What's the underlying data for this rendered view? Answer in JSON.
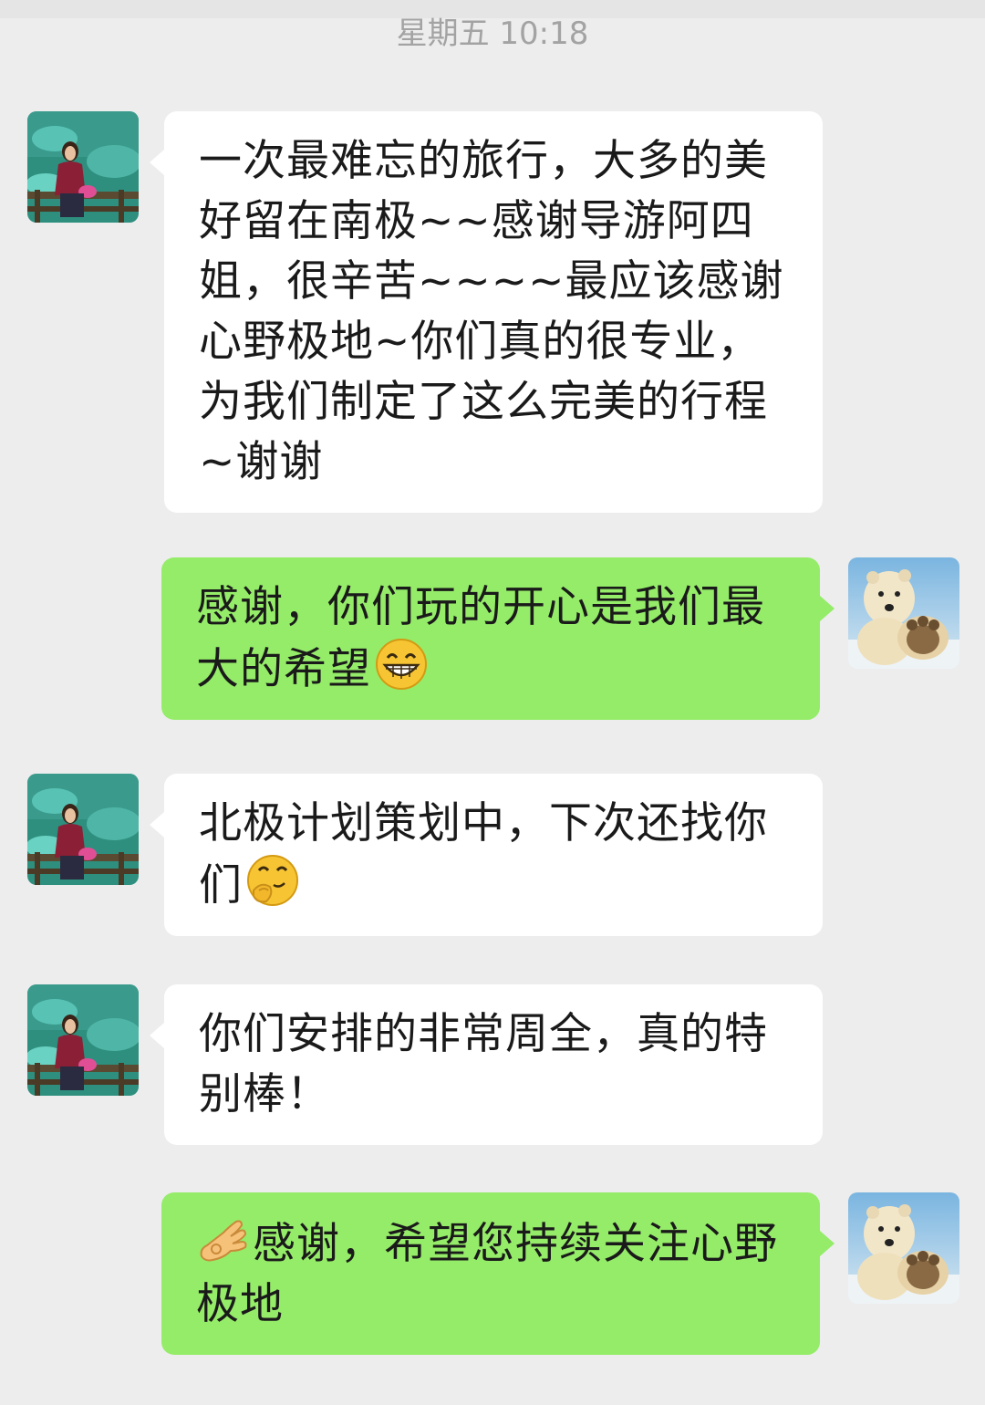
{
  "chat": {
    "timestamp": "星期五 10:18",
    "messages": [
      {
        "sender": "customer",
        "text": "一次最难忘的旅行，大多的美好留在南极~~感谢导游阿四姐，很辛苦~~~~最应该感谢心野极地~你们真的很专业，为我们制定了这么完美的行程~谢谢"
      },
      {
        "sender": "agency",
        "text": "感谢，你们玩的开心是我们最大的希望",
        "emoji": "grinning-face-icon"
      },
      {
        "sender": "customer",
        "text": "北极计划策划中，下次还找你们",
        "emoji": "thinking-face-icon"
      },
      {
        "sender": "customer",
        "text": "你们安排的非常周全，真的特别棒！"
      },
      {
        "sender": "agency",
        "text": "感谢，希望您持续关注心野极地",
        "emoji": "ok-hand-icon"
      }
    ]
  },
  "colors": {
    "background": "#ededed",
    "incoming_bubble": "#ffffff",
    "outgoing_bubble": "#95ec69",
    "timestamp": "#a3a3a3"
  }
}
